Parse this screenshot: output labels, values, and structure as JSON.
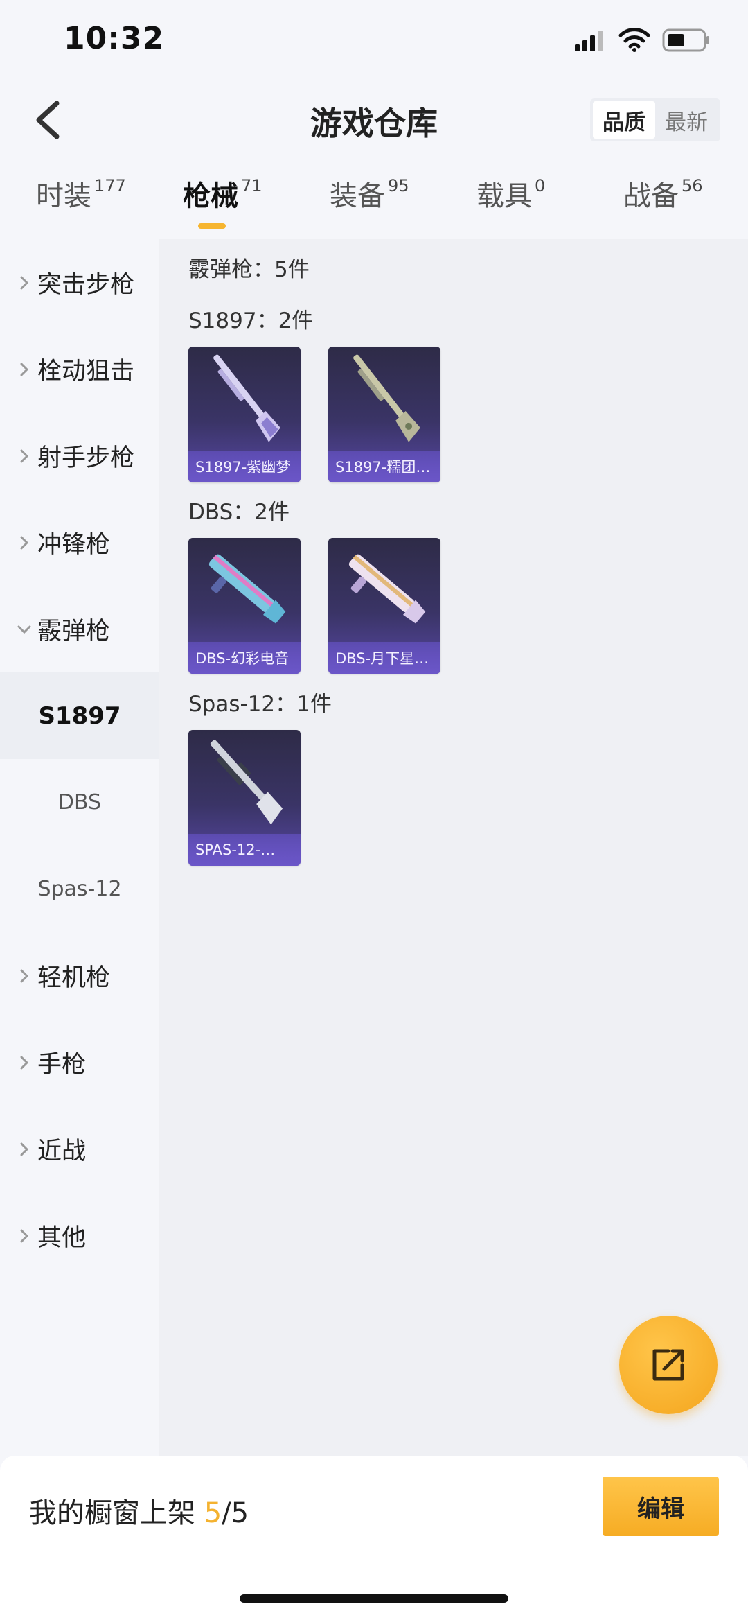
{
  "status": {
    "time": "10:32"
  },
  "header": {
    "title": "游戏仓库",
    "sort": [
      "品质",
      "最新"
    ]
  },
  "tabs": [
    {
      "label": "时装",
      "count": "177"
    },
    {
      "label": "枪械",
      "count": "71"
    },
    {
      "label": "装备",
      "count": "95"
    },
    {
      "label": "载具",
      "count": "0"
    },
    {
      "label": "战备",
      "count": "56"
    }
  ],
  "sidebar": {
    "categories": [
      "突击步枪",
      "栓动狙击",
      "射手步枪",
      "冲锋枪",
      "霰弹枪"
    ],
    "subs": [
      "S1897",
      "DBS",
      "Spas-12"
    ],
    "more": [
      "轻机枪",
      "手枪",
      "近战",
      "其他"
    ]
  },
  "content": {
    "summary": "霰弹枪：5件",
    "groups": [
      {
        "title": "S1897：2件",
        "items": [
          "S1897-紫幽梦",
          "S1897-糯团…"
        ]
      },
      {
        "title": "DBS：2件",
        "items": [
          "DBS-幻彩电音",
          "DBS-月下星…"
        ]
      },
      {
        "title": "Spas-12：1件",
        "items": [
          "SPAS-12-…"
        ]
      }
    ]
  },
  "bottom": {
    "label": "我的橱窗上架 ",
    "count": "5",
    "total": "/5",
    "edit": "编辑"
  },
  "colors": {
    "accent": "#f6b530",
    "card": "#3a3466"
  }
}
